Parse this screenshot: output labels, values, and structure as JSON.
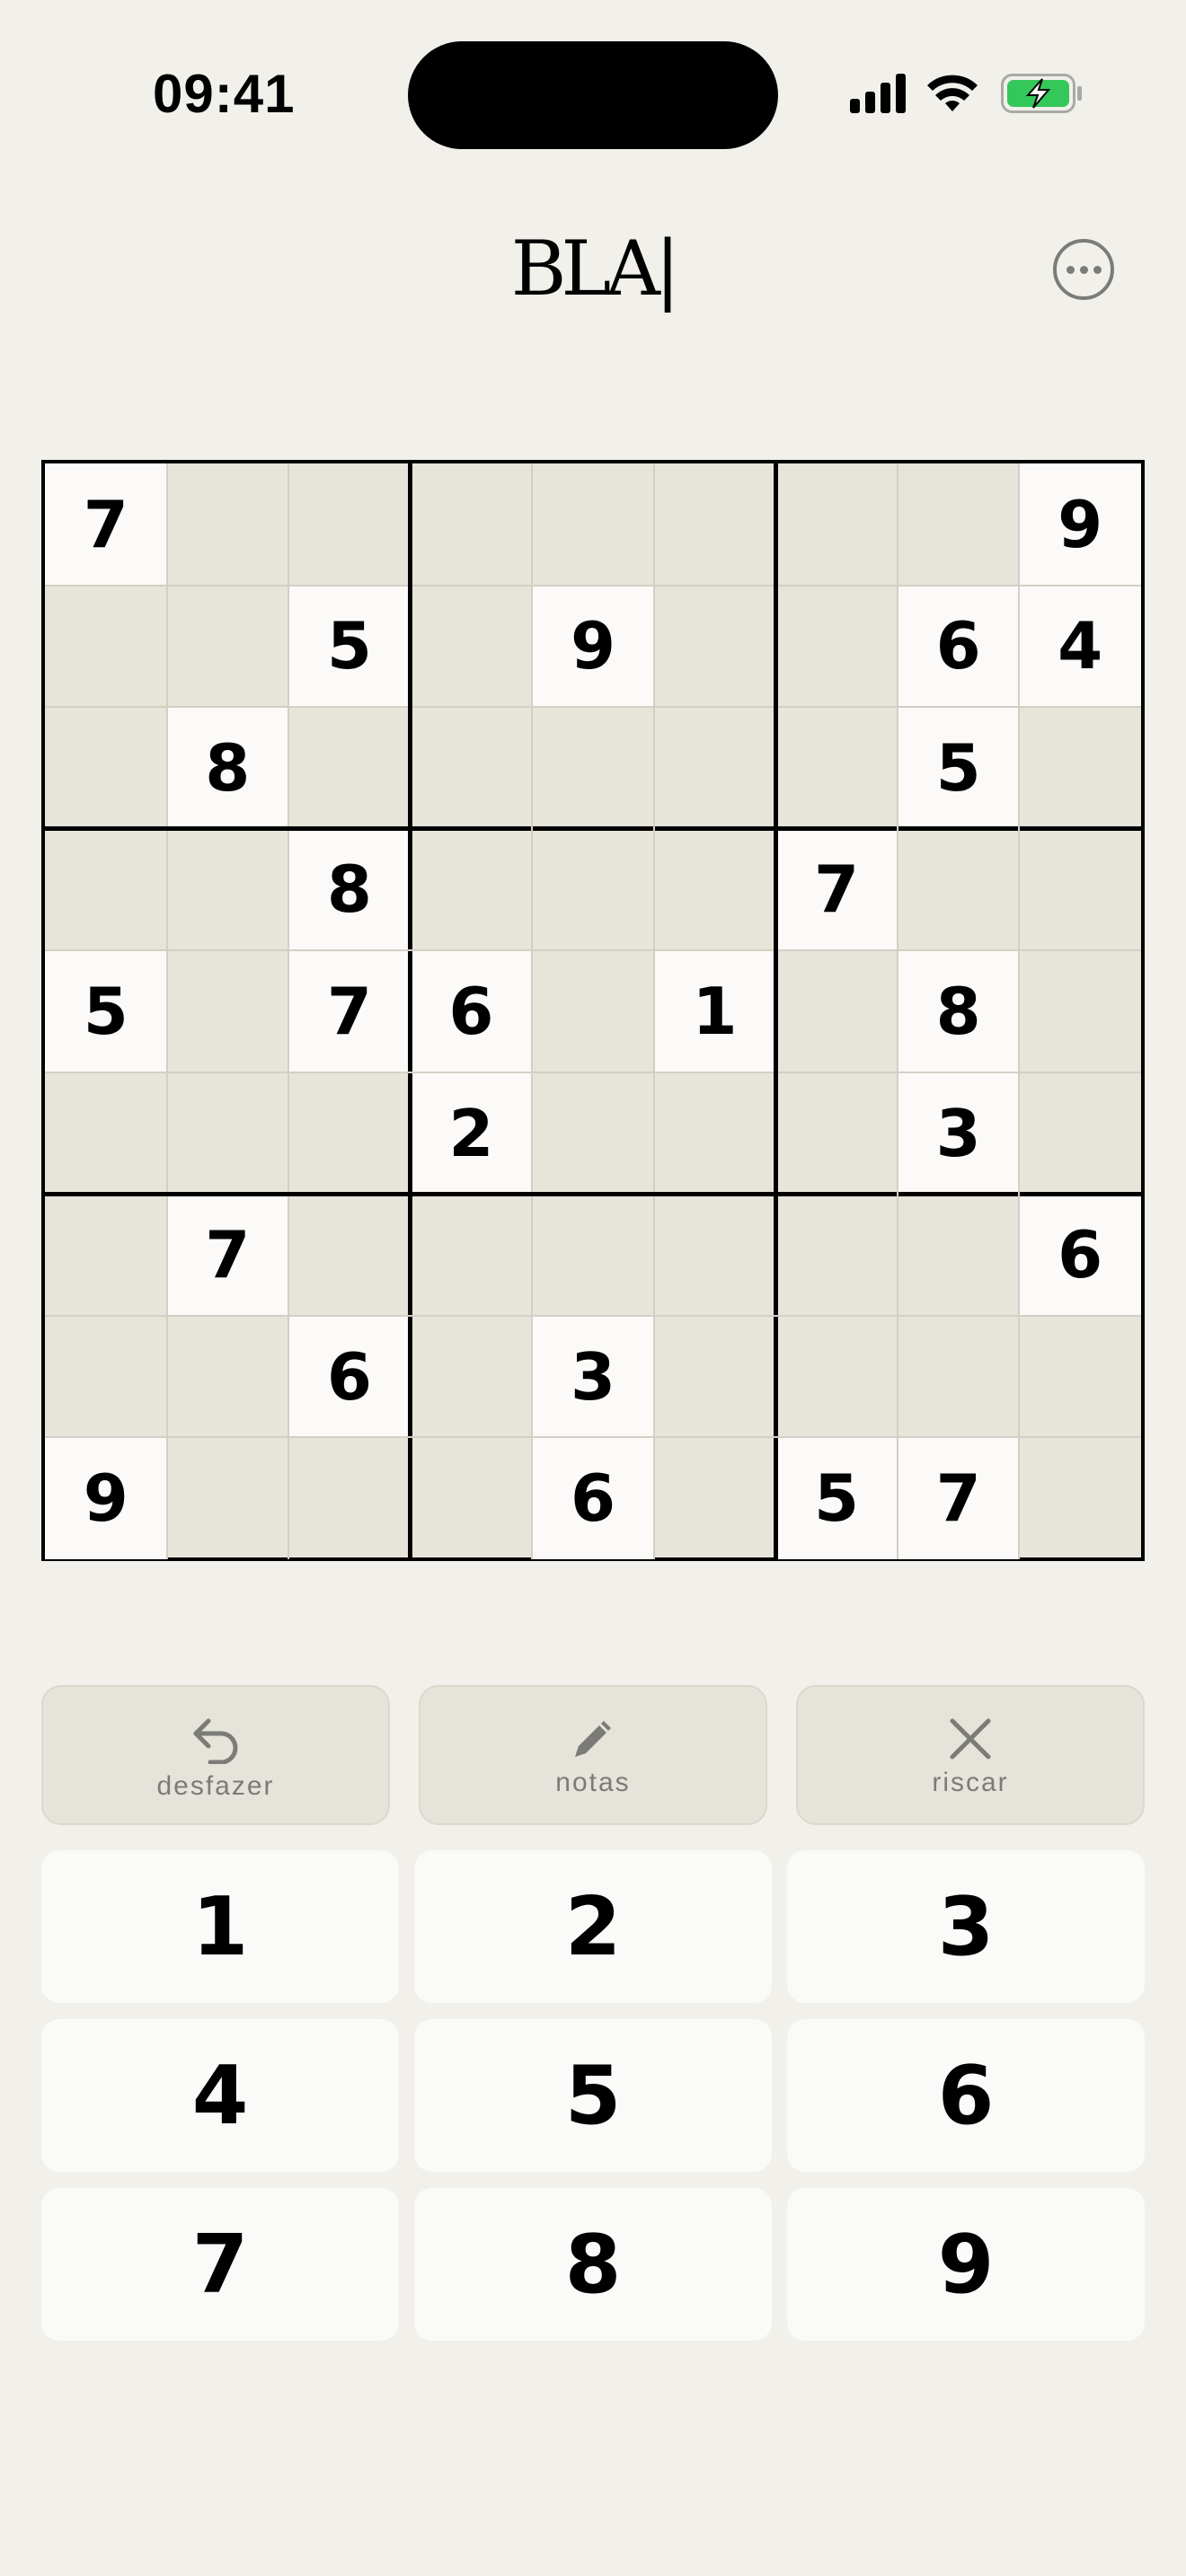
{
  "status_bar": {
    "time": "09:41"
  },
  "header": {
    "title": "BLA|",
    "more_icon": "more-horizontal-icon"
  },
  "board": {
    "rows": [
      [
        "7",
        "",
        "",
        "",
        "",
        "",
        "",
        "",
        "9"
      ],
      [
        "",
        "",
        "5",
        "",
        "9",
        "",
        "",
        "6",
        "4"
      ],
      [
        "",
        "8",
        "",
        "",
        "",
        "",
        "",
        "5",
        ""
      ],
      [
        "",
        "",
        "8",
        "",
        "",
        "",
        "7",
        "",
        ""
      ],
      [
        "5",
        "",
        "7",
        "6",
        "",
        "1",
        "",
        "8",
        ""
      ],
      [
        "",
        "",
        "",
        "2",
        "",
        "",
        "",
        "3",
        ""
      ],
      [
        "",
        "7",
        "",
        "",
        "",
        "",
        "",
        "",
        "6"
      ],
      [
        "",
        "",
        "6",
        "",
        "3",
        "",
        "",
        "",
        ""
      ],
      [
        "9",
        "",
        "",
        "",
        "6",
        "",
        "5",
        "7",
        ""
      ]
    ]
  },
  "actions": [
    {
      "label": "desfazer",
      "icon": "undo-icon"
    },
    {
      "label": "notas",
      "icon": "pencil-icon"
    },
    {
      "label": "riscar",
      "icon": "close-icon"
    }
  ],
  "numpad": [
    "1",
    "2",
    "3",
    "4",
    "5",
    "6",
    "7",
    "8",
    "9"
  ],
  "colors": {
    "background": "#f2f0eb",
    "cell_empty": "#e7e4da",
    "cell_given": "#fbfaf8",
    "battery": "#34c759"
  }
}
